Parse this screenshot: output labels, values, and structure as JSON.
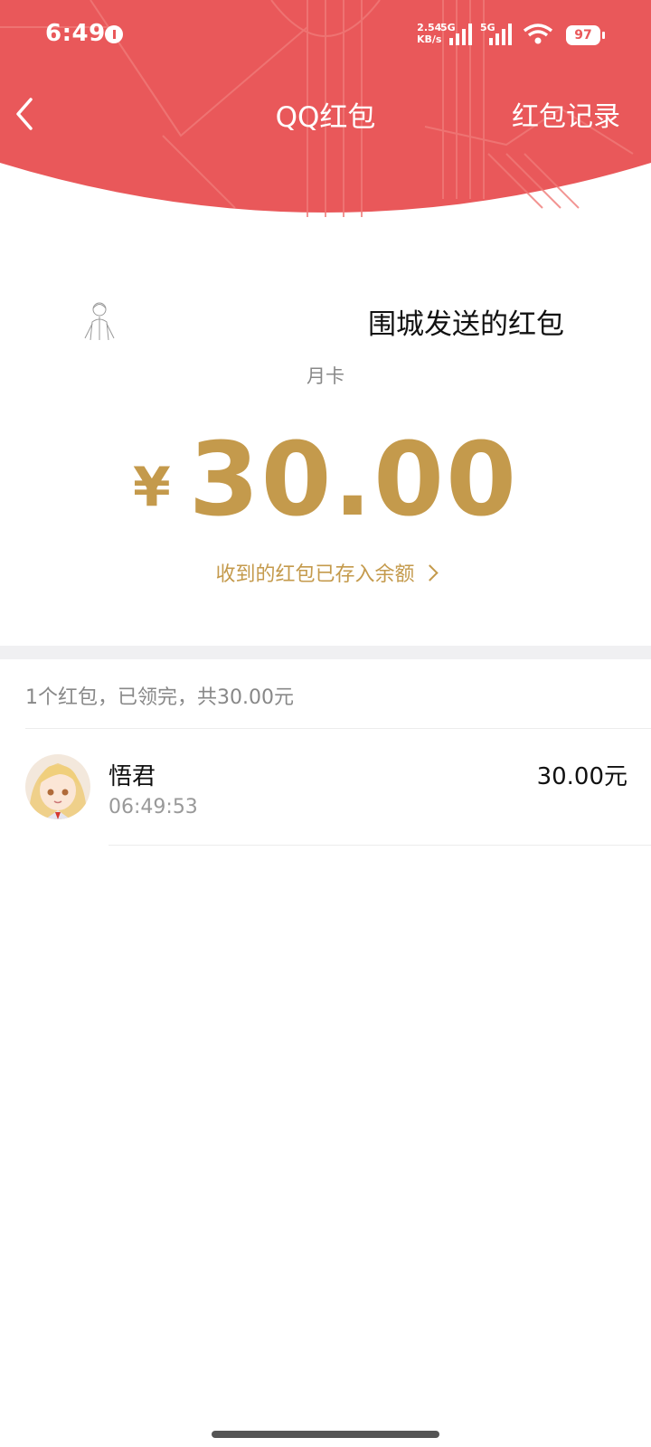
{
  "status_bar": {
    "time": "6:49",
    "net_speed_value": "2.54",
    "net_speed_unit": "KB/s",
    "sim1": "5G",
    "sim2": "5G",
    "battery": "97"
  },
  "header": {
    "title": "QQ红包",
    "records_label": "红包记录",
    "accent_color": "#e9585a"
  },
  "packet": {
    "sender_title": "围城发送的红包",
    "note": "月卡",
    "currency": "¥",
    "amount": "30.00",
    "balance_link": "收到的红包已存入余额"
  },
  "summary": "1个红包，已领完，共30.00元",
  "receivers": [
    {
      "name": "悟君",
      "time": "06:49:53",
      "amount": "30.00元"
    }
  ],
  "icons": {
    "back": "chevron-left-icon",
    "balance_link": "chevron-right-icon",
    "wifi": "wifi-icon",
    "signal": "signal-icon",
    "info": "info-icon"
  }
}
